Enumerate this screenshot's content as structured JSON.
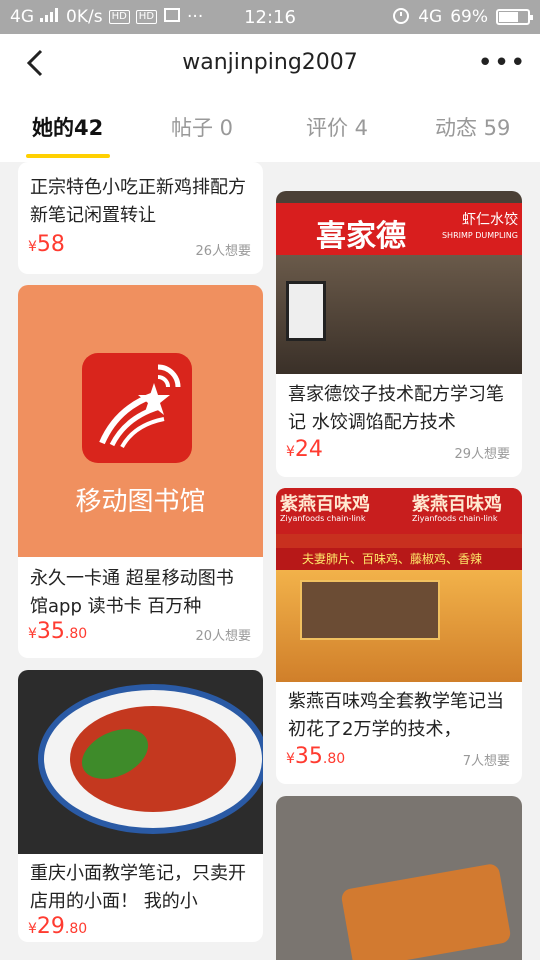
{
  "status_bar": {
    "network_left": "4G",
    "speed": "0K/s",
    "hd1": "HD",
    "hd2": "HD",
    "dots": "···",
    "time": "12:16",
    "network_right": "4G",
    "battery": "69%",
    "battery_level": 0.69
  },
  "nav": {
    "title": "wanjinping2007",
    "more": "•••"
  },
  "tabs": [
    {
      "label": "她的42"
    },
    {
      "label": "帖子 0"
    },
    {
      "label": "评价 4"
    },
    {
      "label": "动态 59"
    }
  ],
  "items": {
    "top_left": {
      "title": "正宗特色小吃正新鸡排配方新笔记闲置转让",
      "price_symbol": "¥",
      "price_int": "58",
      "price_dec": "",
      "wants": "26人想要"
    },
    "library": {
      "image_text": "移动图书馆",
      "title": "永久一卡通 超星移动图书馆app 读书卡 百万种",
      "price_symbol": "¥",
      "price_int": "35",
      "price_dec": ".80",
      "wants": "20人想要"
    },
    "noodle": {
      "title": "重庆小面教学笔记，只卖开店用的小面！ 我的小",
      "price_symbol": "¥",
      "price_int": "29",
      "price_dec": ".80"
    },
    "dumpling": {
      "sign_main": "喜家德",
      "sign_side": "虾仁水饺",
      "sign_en": "SHRIMP DUMPLING",
      "title": "喜家德饺子技术配方学习笔记 水饺调馅配方技术",
      "price_symbol": "¥",
      "price_int": "24",
      "price_dec": "",
      "wants": "29人想要"
    },
    "chicken": {
      "sign_cn_1": "紫燕百味鸡",
      "sign_cn_2": "紫燕百味鸡",
      "sign_en_1": "Ziyanfoods chain-link",
      "sign_en_2": "Ziyanfoods chain-link",
      "banner": "夫妻肺片、百味鸡、藤椒鸡、香辣",
      "title": "紫燕百味鸡全套教学笔记当初花了2万学的技术，",
      "price_symbol": "¥",
      "price_int": "35",
      "price_dec": ".80",
      "wants": "7人想要"
    }
  },
  "colors": {
    "accent_yellow": "#ffd000",
    "price_red": "#ff3b30"
  }
}
